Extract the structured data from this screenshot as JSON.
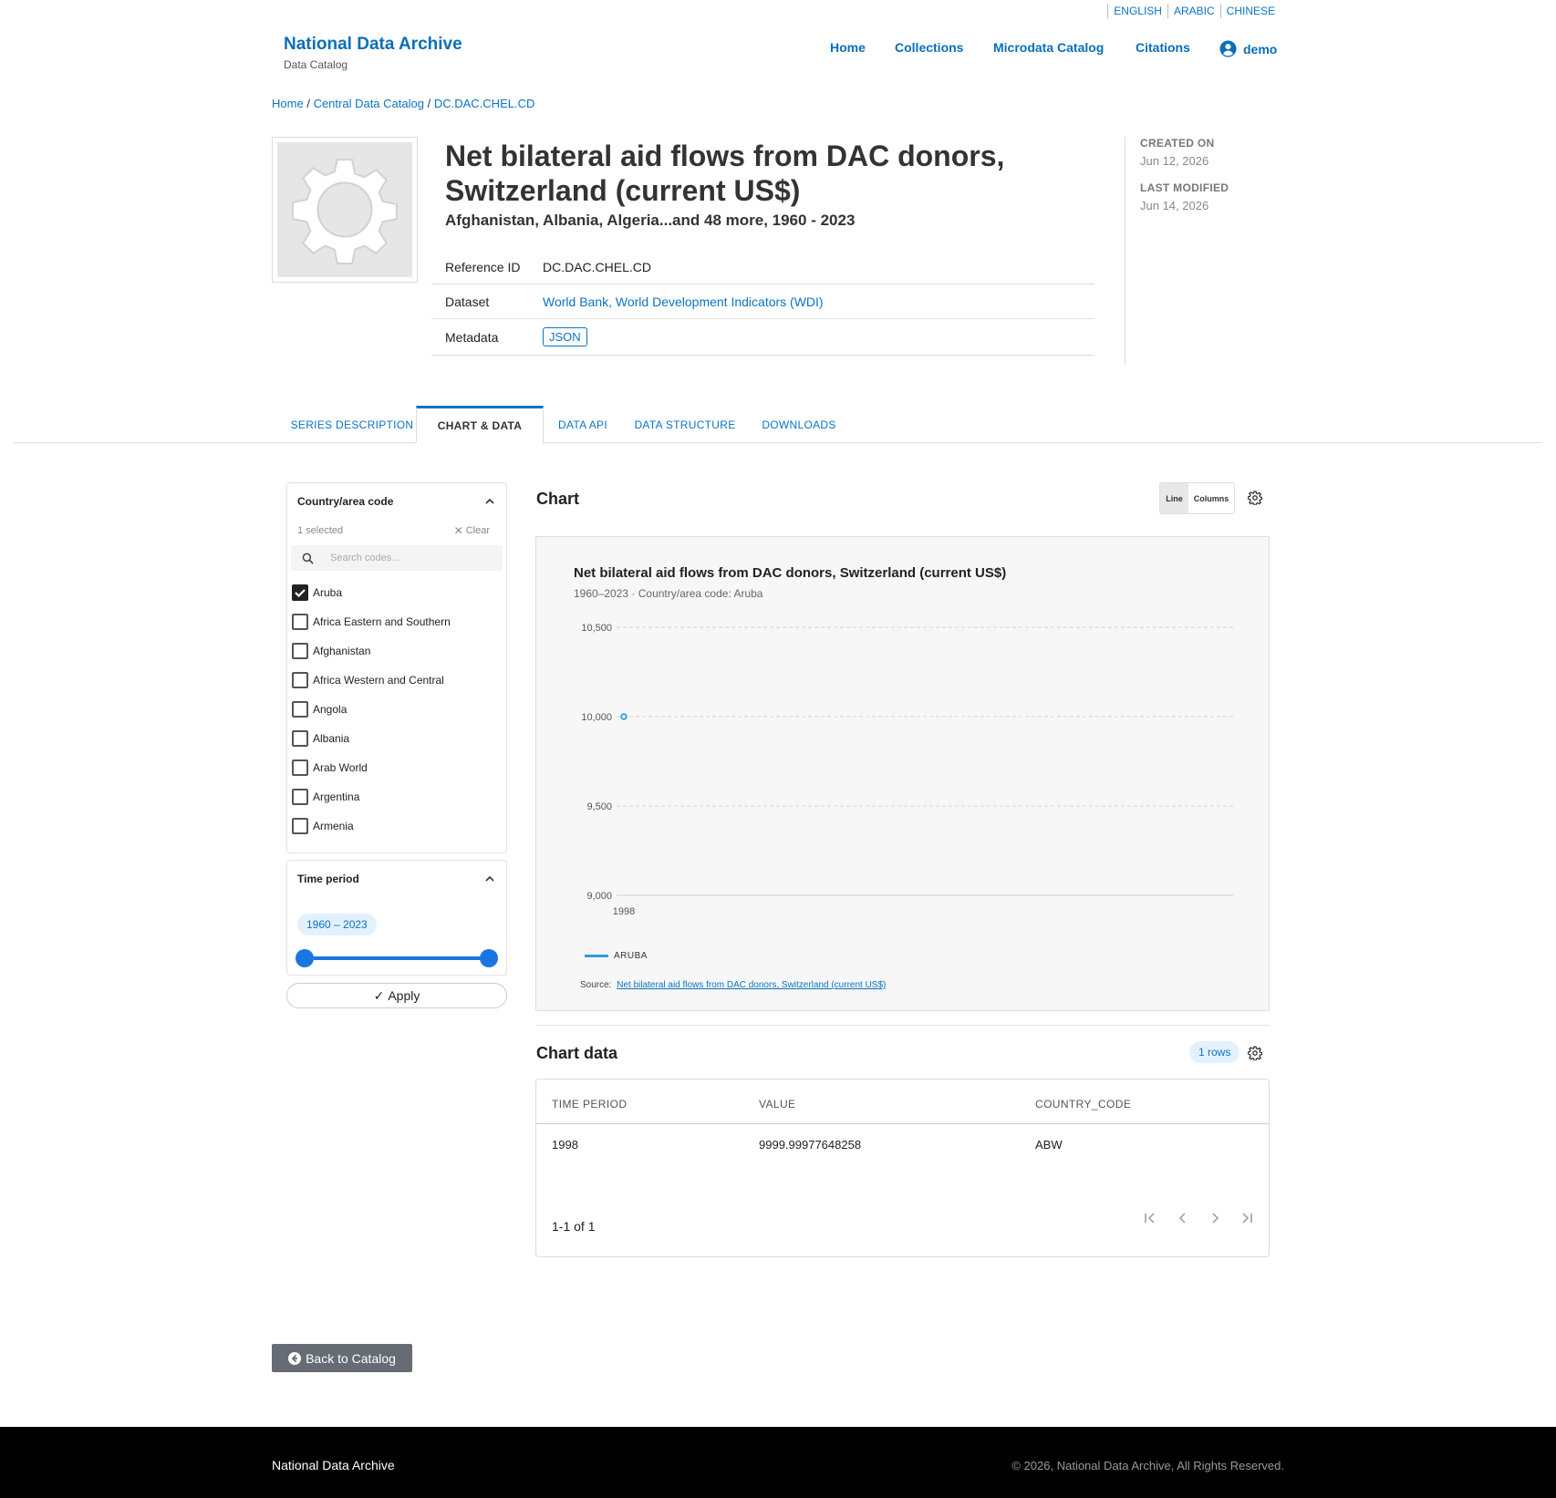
{
  "lang": [
    "ENGLISH",
    "ARABIC",
    "CHINESE"
  ],
  "site": {
    "title": "National Data Archive",
    "subtitle": "Data Catalog"
  },
  "nav": {
    "home": "Home",
    "collections": "Collections",
    "microdata": "Microdata Catalog",
    "citations": "Citations",
    "user": "demo"
  },
  "breadcrumb": {
    "home": "Home",
    "catalog": "Central Data Catalog",
    "current": "DC.DAC.CHEL.CD",
    "sep": "/"
  },
  "page": {
    "title": "Net bilateral aid flows from DAC donors, Switzerland (current US$)",
    "subtitle": "Afghanistan, Albania, Algeria...and 48 more, 1960 - 2023"
  },
  "meta": {
    "ref_label": "Reference ID",
    "ref_value": "DC.DAC.CHEL.CD",
    "dataset_label": "Dataset",
    "dataset_value": "World Bank, World Development Indicators (WDI)",
    "metadata_label": "Metadata",
    "metadata_value": "JSON"
  },
  "side": {
    "created_label": "CREATED ON",
    "created_value": "Jun 12, 2026",
    "modified_label": "LAST MODIFIED",
    "modified_value": "Jun 14, 2026"
  },
  "tabs": [
    "SERIES DESCRIPTION",
    "CHART & DATA",
    "DATA API",
    "DATA STRUCTURE",
    "DOWNLOADS"
  ],
  "filter": {
    "title": "Country/area code",
    "selected": "1 selected",
    "clear": "Clear",
    "search_placeholder": "Search codes...",
    "options": [
      {
        "label": "Aruba",
        "checked": true
      },
      {
        "label": "Africa Eastern and Southern",
        "checked": false
      },
      {
        "label": "Afghanistan",
        "checked": false
      },
      {
        "label": "Africa Western and Central",
        "checked": false
      },
      {
        "label": "Angola",
        "checked": false
      },
      {
        "label": "Albania",
        "checked": false
      },
      {
        "label": "Arab World",
        "checked": false
      },
      {
        "label": "Argentina",
        "checked": false
      },
      {
        "label": "Armenia",
        "checked": false
      }
    ]
  },
  "period": {
    "title": "Time period",
    "range": "1960 – 2023"
  },
  "apply_label": "Apply",
  "chart_section": {
    "heading": "Chart",
    "line": "Line",
    "columns": "Columns"
  },
  "chart_data": {
    "type": "line",
    "title": "Net bilateral aid flows from DAC donors, Switzerland (current US$)",
    "subtitle": "1960–2023 · Country/area code: Aruba",
    "categories": [
      "1998"
    ],
    "series": [
      {
        "name": "ARUBA",
        "values": [
          9999.99977648258
        ]
      }
    ],
    "ylim": [
      9000,
      10500
    ],
    "yticks": [
      "9,000",
      "9,500",
      "10,000",
      "10,500"
    ],
    "ytick_values": [
      9000,
      9500,
      10000,
      10500
    ],
    "grid": true,
    "legend": "bottom-left",
    "source_label": "Source:",
    "source_text": "Net bilateral aid flows from DAC donors, Switzerland (current US$)",
    "color": "#2f9be0"
  },
  "table": {
    "heading": "Chart data",
    "rows_badge": "1 rows",
    "columns": [
      "TIME PERIOD",
      "VALUE",
      "COUNTRY_CODE"
    ],
    "rows": [
      [
        "1998",
        "9999.99977648258",
        "ABW"
      ]
    ],
    "pagination": "1-1 of 1"
  },
  "back_label": "Back to Catalog",
  "footer": {
    "left": "National Data Archive",
    "right": "© 2026, National Data Archive, All Rights Reserved."
  }
}
